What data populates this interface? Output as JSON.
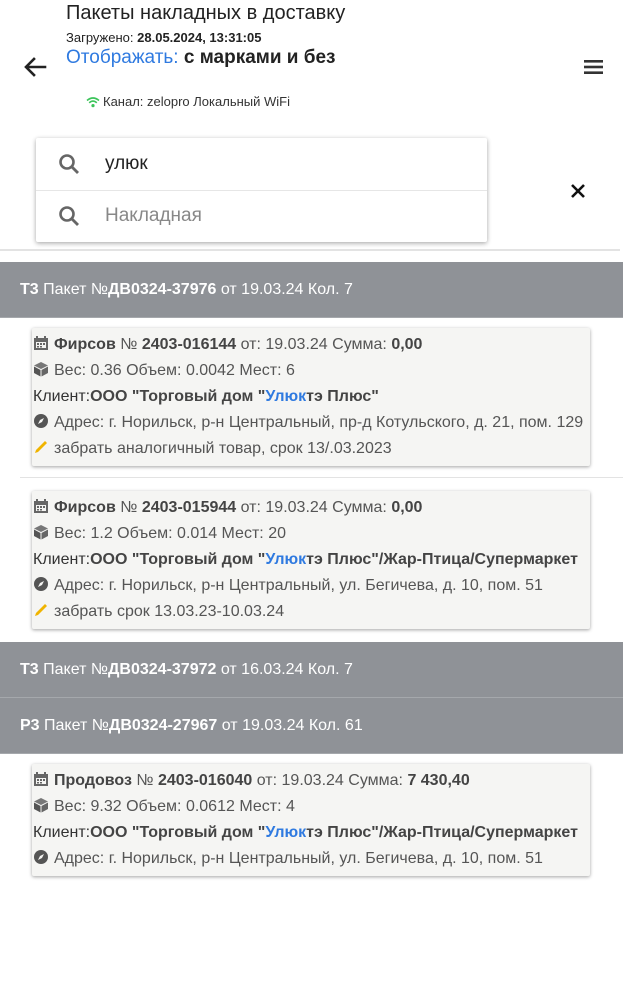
{
  "header": {
    "title": "Пакеты накладных в доставку",
    "loaded_label": "Загружено:",
    "loaded_value": "28.05.2024, 13:31:05",
    "display_label": "Отображать:",
    "display_value": "с марками и без",
    "channel": "Канал: zelopro Локальный WiFi"
  },
  "search": {
    "query_value": "улюк",
    "invoice_placeholder": "Накладная"
  },
  "colors": {
    "accent": "#2f7ae0",
    "package_header": "#8f9297",
    "wifi": "#3bc45a",
    "pencil": "#f0b400"
  },
  "packages": [
    {
      "type": "Т3",
      "label": "Пакет №",
      "number": "ДВ0324-37976",
      "date_label": "от",
      "date": "19.03.24",
      "count_label": "Кол.",
      "count": "7",
      "invoices": [
        {
          "supplier": "Фирсов",
          "num_label": "№",
          "num": "2403-016144",
          "from_label": "от:",
          "date": "19.03.24",
          "sum_label": "Сумма:",
          "sum": "0,00",
          "weight_label": "Вес:",
          "weight": "0.36",
          "volume_label": "Объем:",
          "volume": "0.0042",
          "places_label": "Мест:",
          "places": "6",
          "client_label": "Клиент:",
          "client_pre": "ООО \"Торговый дом \"",
          "client_hl": "Улюк",
          "client_post": "тэ Плюс\"",
          "address": "Адрес: г. Норильск, р-н Центральный, пр-д Котульского, д. 21, пом. 129",
          "note": "забрать аналогичный товар, срок 13/.03.2023"
        },
        {
          "supplier": "Фирсов",
          "num_label": "№",
          "num": "2403-015944",
          "from_label": "от:",
          "date": "19.03.24",
          "sum_label": "Сумма:",
          "sum": "0,00",
          "weight_label": "Вес:",
          "weight": "1.2",
          "volume_label": "Объем:",
          "volume": "0.014",
          "places_label": "Мест:",
          "places": "20",
          "client_label": "Клиент:",
          "client_pre": "ООО \"Торговый дом \"",
          "client_hl": "Улюк",
          "client_post": "тэ Плюс\"/Жар-Птица/Супермаркет",
          "address": "Адрес: г. Норильск, р-н Центральный, ул. Бегичева, д. 10, пом. 51",
          "note": "забрать срок 13.03.23-10.03.24"
        }
      ]
    },
    {
      "type": "Т3",
      "label": "Пакет №",
      "number": "ДВ0324-37972",
      "date_label": "от",
      "date": "16.03.24",
      "count_label": "Кол.",
      "count": "7",
      "invoices": []
    },
    {
      "type": "Р3",
      "label": "Пакет №",
      "number": "ДВ0324-27967",
      "date_label": "от",
      "date": "19.03.24",
      "count_label": "Кол.",
      "count": "61",
      "invoices": [
        {
          "supplier": "Продовоз",
          "num_label": "№",
          "num": "2403-016040",
          "from_label": "от:",
          "date": "19.03.24",
          "sum_label": "Сумма:",
          "sum": "7 430,40",
          "weight_label": "Вес:",
          "weight": "9.32",
          "volume_label": "Объем:",
          "volume": "0.0612",
          "places_label": "Мест:",
          "places": "4",
          "client_label": "Клиент:",
          "client_pre": "ООО \"Торговый дом \"",
          "client_hl": "Улюк",
          "client_post": "тэ Плюс\"/Жар-Птица/Супермаркет",
          "address": "Адрес: г. Норильск, р-н Центральный, ул. Бегичева, д. 10, пом. 51",
          "note": ""
        }
      ]
    }
  ]
}
